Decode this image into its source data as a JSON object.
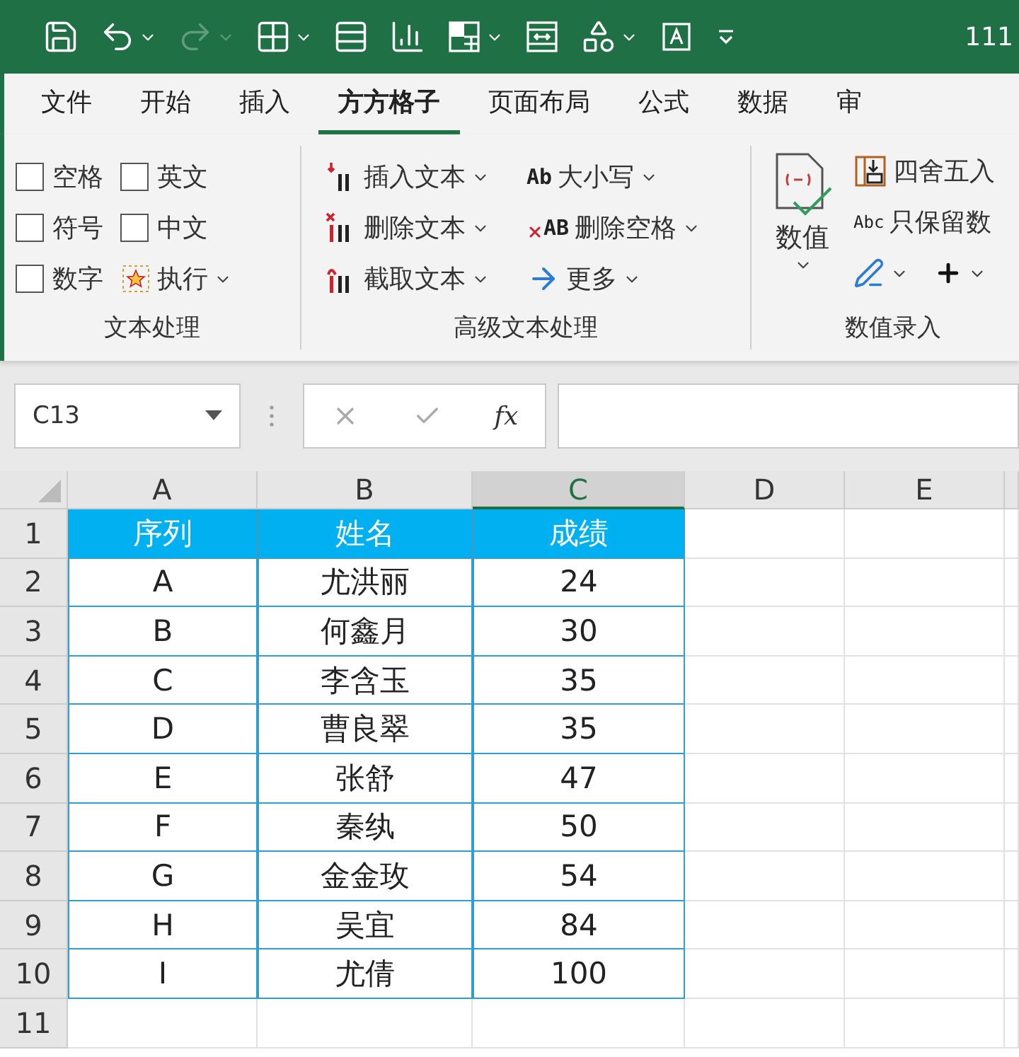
{
  "title_bar": {
    "quick_access": [
      {
        "dropdown": false,
        "disabled": false
      },
      {
        "dropdown": true,
        "disabled": false
      },
      {
        "dropdown": true,
        "disabled": true
      },
      {
        "dropdown": true,
        "disabled": false
      },
      {
        "dropdown": false,
        "disabled": false
      },
      {
        "dropdown": false,
        "disabled": false
      },
      {
        "dropdown": true,
        "disabled": false
      },
      {
        "dropdown": false,
        "disabled": false
      },
      {
        "dropdown": true,
        "disabled": false
      },
      {
        "dropdown": false,
        "disabled": false
      },
      {
        "dropdown": false,
        "disabled": false
      }
    ],
    "title": "111"
  },
  "tabs": [
    {
      "label": "文件",
      "selected": false
    },
    {
      "label": "开始",
      "selected": false
    },
    {
      "label": "插入",
      "selected": false
    },
    {
      "label": "方方格子",
      "selected": true
    },
    {
      "label": "页面布局",
      "selected": false
    },
    {
      "label": "公式",
      "selected": false
    },
    {
      "label": "数据",
      "selected": false
    },
    {
      "label": "审",
      "selected": false
    }
  ],
  "ribbon": {
    "groups": [
      {
        "label": "文本处理",
        "checkboxes": [
          {
            "label": "空格",
            "checked": false
          },
          {
            "label": "英文",
            "checked": false
          },
          {
            "label": "符号",
            "checked": false
          },
          {
            "label": "中文",
            "checked": false
          },
          {
            "label": "数字",
            "checked": false
          }
        ],
        "run_button": "执行"
      },
      {
        "label": "高级文本处理",
        "commands": [
          {
            "label": "插入文本",
            "kind": "insert"
          },
          {
            "label": "大小写",
            "kind": "case",
            "icon_text": "Ab"
          },
          {
            "label": "删除文本",
            "kind": "delete"
          },
          {
            "label": "删除空格",
            "kind": "delspace",
            "icon_text": "AB"
          },
          {
            "label": "截取文本",
            "kind": "cut"
          },
          {
            "label": "更多",
            "kind": "more"
          }
        ]
      },
      {
        "label": "数值录入",
        "big_button": "数值",
        "commands": [
          {
            "label": "四舍五入",
            "kind": "round"
          },
          {
            "label": "只保留数",
            "kind": "keep",
            "icon_text": "Abc"
          }
        ]
      }
    ]
  },
  "formula_bar": {
    "name_box": "C13",
    "fx": "fx"
  },
  "sheet": {
    "columns": [
      {
        "label": "A",
        "selected": false
      },
      {
        "label": "B",
        "selected": false
      },
      {
        "label": "C",
        "selected": true
      },
      {
        "label": "D",
        "selected": false
      },
      {
        "label": "E",
        "selected": false
      }
    ],
    "rows": [
      {
        "number": "1",
        "cells": [
          "序列",
          "姓名",
          "成绩"
        ],
        "header": true
      },
      {
        "number": "2",
        "cells": [
          "A",
          "尤洪丽",
          "24"
        ],
        "header": false
      },
      {
        "number": "3",
        "cells": [
          "B",
          "何鑫月",
          "30"
        ],
        "header": false
      },
      {
        "number": "4",
        "cells": [
          "C",
          "李含玉",
          "35"
        ],
        "header": false
      },
      {
        "number": "5",
        "cells": [
          "D",
          "曹良翠",
          "35"
        ],
        "header": false
      },
      {
        "number": "6",
        "cells": [
          "E",
          "张舒",
          "47"
        ],
        "header": false
      },
      {
        "number": "7",
        "cells": [
          "F",
          "秦纨",
          "50"
        ],
        "header": false
      },
      {
        "number": "8",
        "cells": [
          "G",
          "金金玫",
          "54"
        ],
        "header": false
      },
      {
        "number": "9",
        "cells": [
          "H",
          "吴宜",
          "84"
        ],
        "header": false
      },
      {
        "number": "10",
        "cells": [
          "I",
          "尤倩",
          "100"
        ],
        "header": false
      },
      {
        "number": "11",
        "cells": [],
        "header": false
      }
    ]
  }
}
